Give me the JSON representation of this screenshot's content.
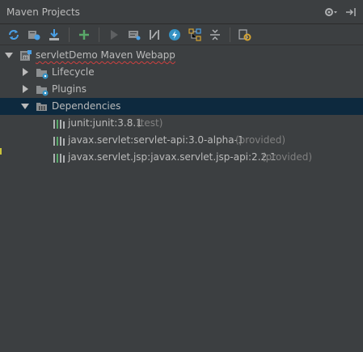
{
  "panel": {
    "title": "Maven Projects",
    "title_icons": [
      "gear-dropdown-icon",
      "hide-panel-icon"
    ]
  },
  "toolbar": {
    "buttons": [
      "reimport-icon",
      "generate-sources-icon",
      "download-icon",
      "add-maven-project-icon",
      "run-icon",
      "execute-goal-icon",
      "toggle-offline-icon",
      "skip-tests-icon",
      "show-dependencies-icon",
      "collapse-all-icon",
      "settings-icon"
    ]
  },
  "tree": {
    "project": "servletDemo Maven Webapp",
    "lifecycle": "Lifecycle",
    "plugins": "Plugins",
    "dependencies": "Dependencies",
    "deps": [
      {
        "name": "junit:junit:3.8.1",
        "scope": "(test)"
      },
      {
        "name": "javax.servlet:servlet-api:3.0-alpha-1",
        "scope": "(provided)"
      },
      {
        "name": "javax.servlet.jsp:javax.servlet.jsp-api:2.2.1",
        "scope": "(provided)"
      }
    ]
  },
  "colors": {
    "background": "#3c3f41",
    "selection": "#0d293e",
    "text": "#bbbbbb",
    "muted": "#808080"
  }
}
